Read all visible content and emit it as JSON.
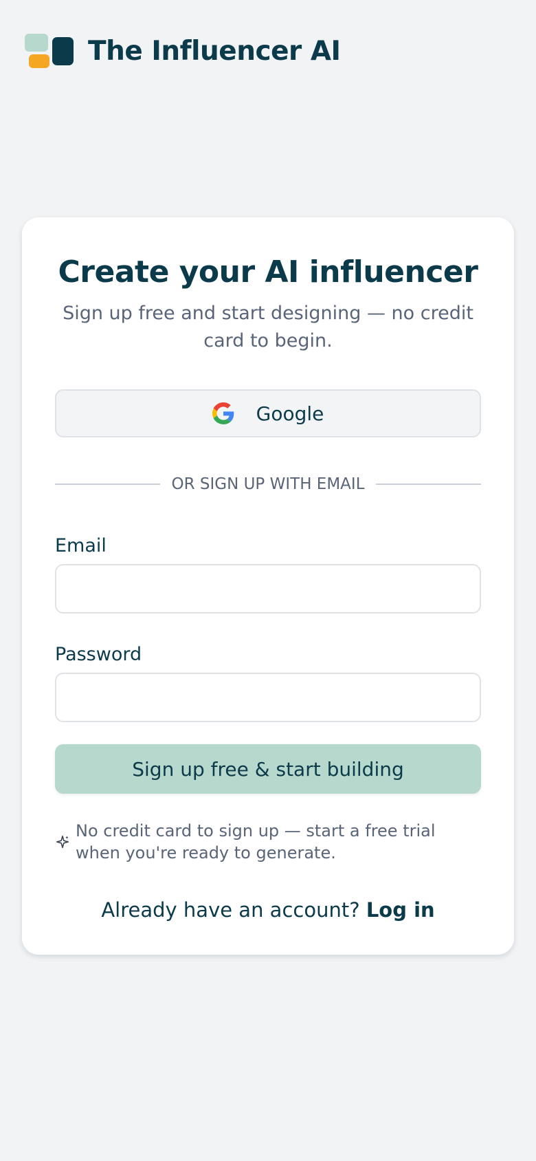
{
  "brand": {
    "name": "The Influencer AI",
    "logo_colors": [
      "#b7d8cc",
      "#f5a623",
      "#0b3a4b"
    ]
  },
  "signup": {
    "title": "Create your AI influencer",
    "subtitle": "Sign up free and start designing — no credit card to begin.",
    "google_button_label": "Google",
    "google_icon": "google-g-icon",
    "divider_text": "OR SIGN UP WITH EMAIL",
    "email_label": "Email",
    "email_value": "",
    "password_label": "Password",
    "password_value": "",
    "submit_label": "Sign up free & start building",
    "note_icon": "sparkle-icon",
    "note_text": "No credit card to sign up — start a free trial when you're ready to generate.",
    "login_prompt": "Already have an account?",
    "login_link": "Log in"
  },
  "colors": {
    "background": "#f1f3f5",
    "primary": "#b7d8cc",
    "text_dark": "#0b3a4b",
    "text_muted": "#5a6478",
    "accent_orange": "#f5a623"
  }
}
